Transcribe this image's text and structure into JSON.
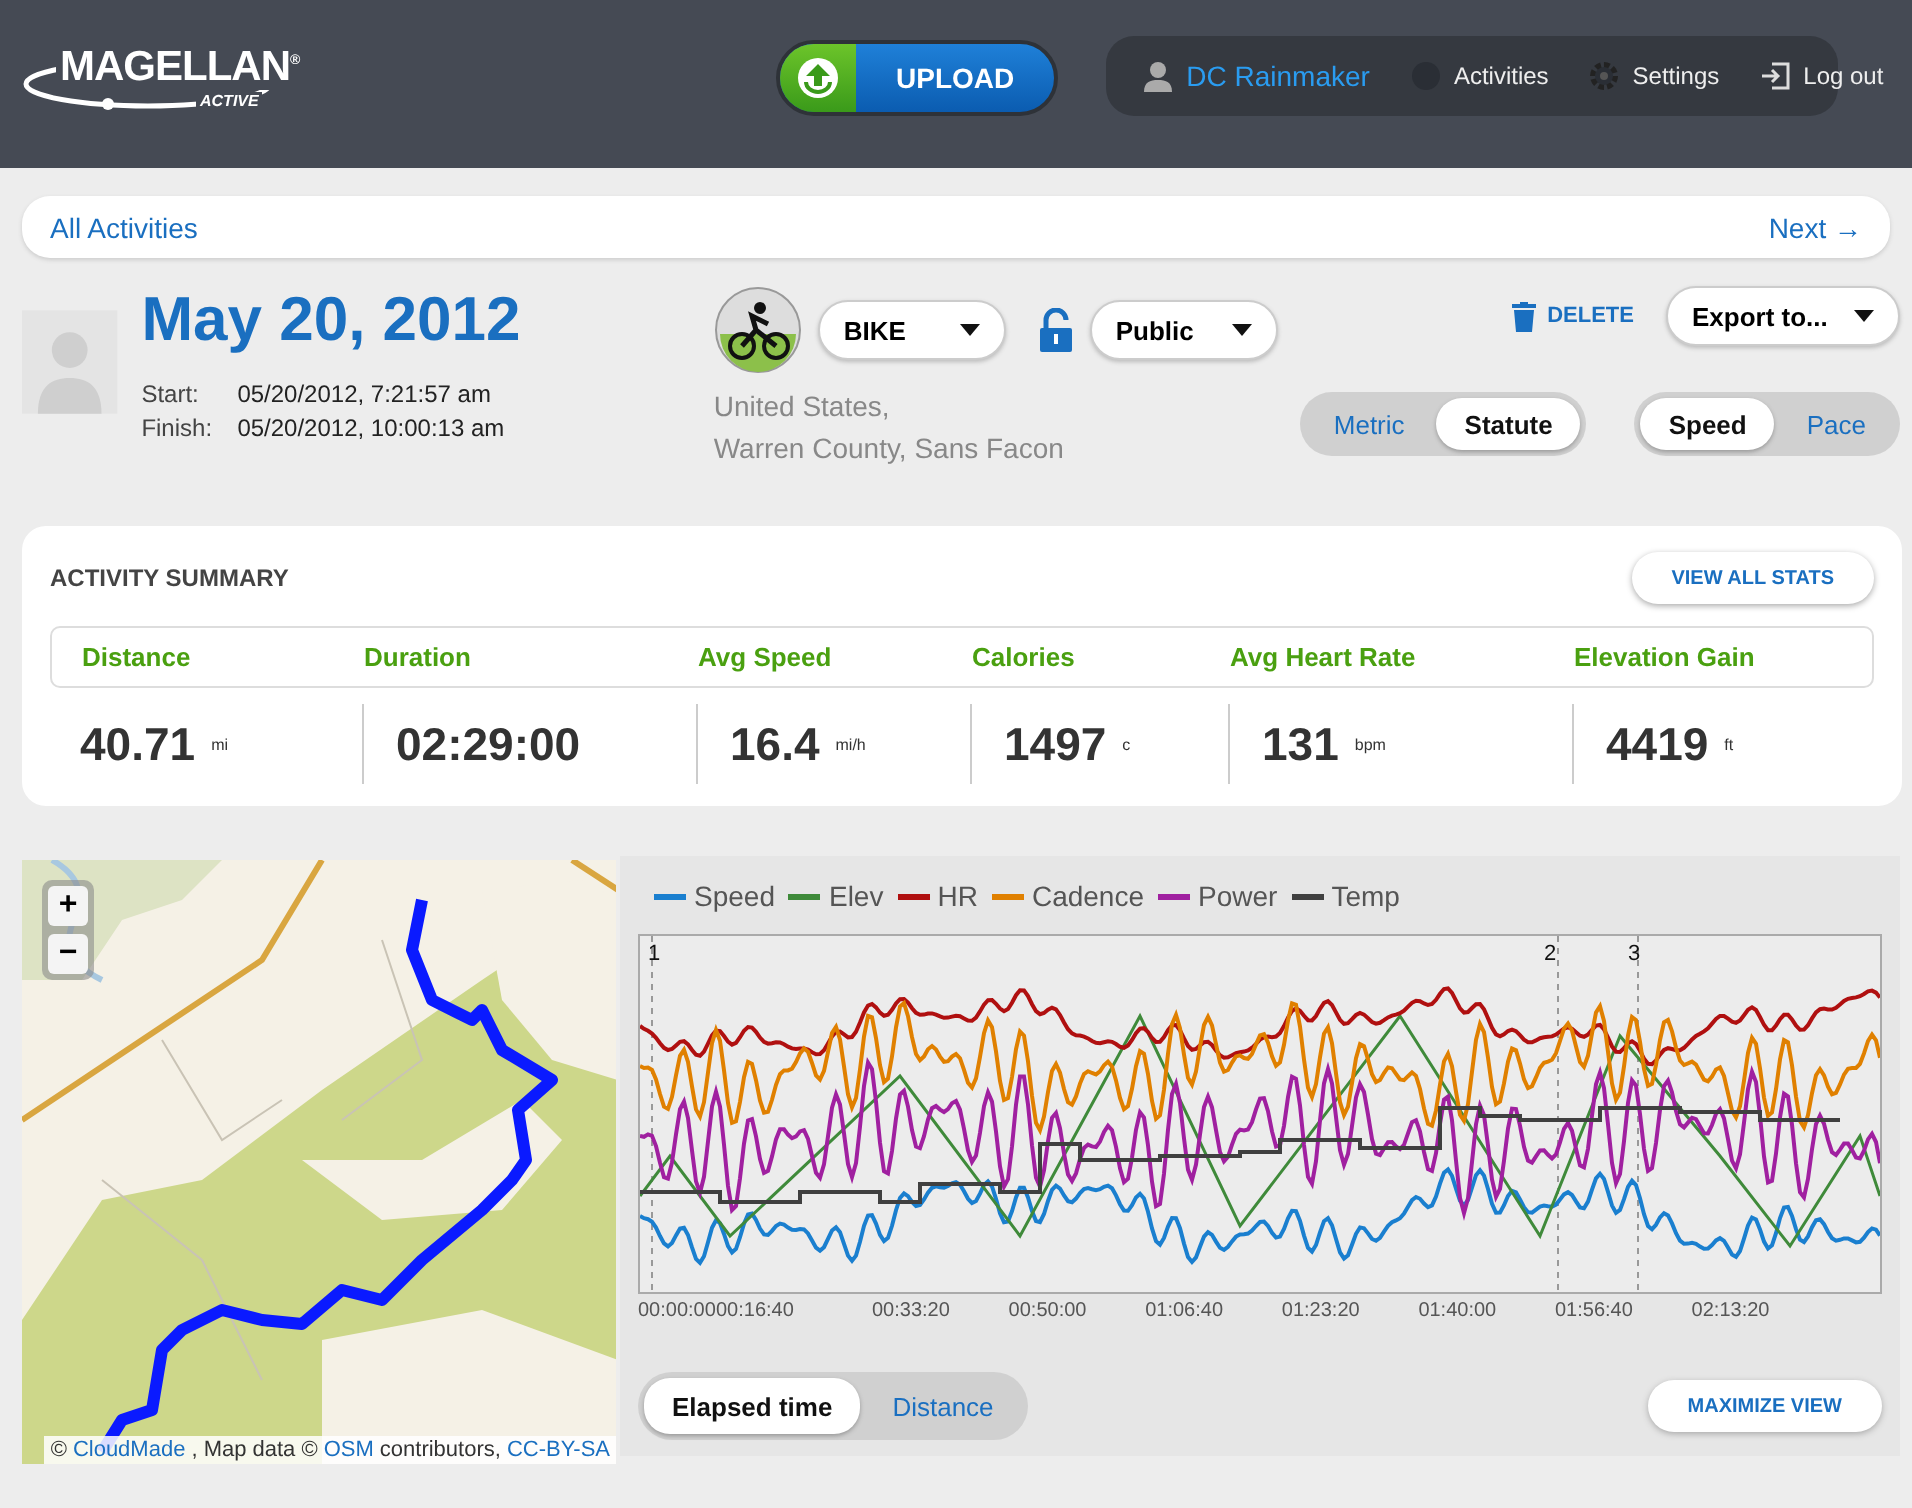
{
  "header": {
    "logo": "MAGELLAN$^{®}$",
    "logo_sub": "ACTIVE",
    "upload": "UPLOAD",
    "user_nav": [
      {
        "kind": "user",
        "label": "DC Rainmaker"
      },
      {
        "kind": "dot",
        "label": "Activities"
      },
      {
        "kind": "gear",
        "label": "Settings"
      },
      {
        "kind": "logout",
        "label": "Log out"
      }
    ]
  },
  "nav": {
    "back": "All Activities",
    "next": "Next →"
  },
  "activity": {
    "title": "May 20, 2012",
    "start_label": "Start:",
    "start": "05/20/2012, 7:21:57 am",
    "finish_label": "Finish:",
    "finish": "05/20/2012, 10:00:13 am",
    "sport": "BIKE",
    "privacy": "Public",
    "location": [
      "United States,",
      "Warren County, Sans Facon"
    ],
    "delete": "DELETE",
    "export": "Export to...",
    "units": [
      {
        "label": "Metric",
        "selected": false
      },
      {
        "label": "Statute",
        "selected": true
      }
    ],
    "mode": [
      {
        "label": "Speed",
        "selected": true
      },
      {
        "label": "Pace",
        "selected": false
      }
    ]
  },
  "summary": {
    "title": "ACTIVITY SUMMARY",
    "view_all": "VIEW ALL STATS",
    "stats": [
      {
        "label": "Distance",
        "value": "40.71",
        "unit": "mi"
      },
      {
        "label": "Duration",
        "value": "02:29:00"
      },
      {
        "label": "Avg Speed",
        "value": "16.4",
        "unit": "mi/h"
      },
      {
        "label": "Calories",
        "value": "1497",
        "unit": "c"
      },
      {
        "label": "Avg Heart Rate",
        "value": "131",
        "unit": "bpm"
      },
      {
        "label": "Elevation Gain",
        "value": "4419",
        "unit": "ft"
      }
    ]
  },
  "map": {
    "zoom_in": "+",
    "zoom_out": "−",
    "attribution": [
      {
        "text": "©",
        "link": false
      },
      {
        "text": "CloudMade",
        "link": true
      },
      {
        "text": ", Map data ©",
        "link": false
      },
      {
        "text": "OSM",
        "link": true
      },
      {
        "text": "contributors,",
        "link": false
      },
      {
        "text": "CC-BY-SA",
        "link": true
      }
    ]
  },
  "chart": {
    "legend": [
      {
        "label": "Speed",
        "color": "#1a7fcf"
      },
      {
        "label": "Elev",
        "color": "#3f8a3a"
      },
      {
        "label": "HR",
        "color": "#b01010"
      },
      {
        "label": "Cadence",
        "color": "#e08000"
      },
      {
        "label": "Power",
        "color": "#a020a0"
      },
      {
        "label": "Temp",
        "color": "#404040"
      }
    ],
    "laps": [
      "1",
      "2",
      "3"
    ],
    "xticks": [
      "00:00:00",
      "00:16:40",
      "00:33:20",
      "00:50:00",
      "01:06:40",
      "01:23:20",
      "01:40:00",
      "01:56:40",
      "02:13:20"
    ],
    "axis": [
      {
        "label": "Elapsed time",
        "selected": true
      },
      {
        "label": "Distance",
        "selected": false
      }
    ],
    "maximize": "MAXIMIZE VIEW"
  }
}
